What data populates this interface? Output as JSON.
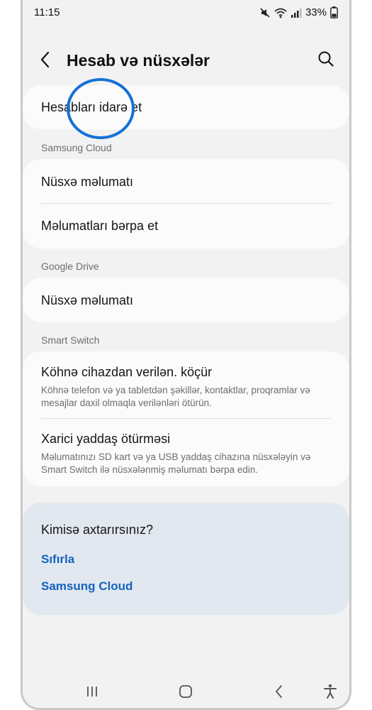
{
  "status_bar": {
    "time": "11:15",
    "battery": "33%"
  },
  "header": {
    "title": "Hesab və nüsxələr",
    "icons": [
      "back-arrow-icon",
      "search-icon"
    ]
  },
  "accounts_card": {
    "item_label": "Hesabları idarə et"
  },
  "samsung_cloud": {
    "section_label": "Samsung Cloud",
    "items": [
      {
        "label": "Nüsxə məlumatı"
      },
      {
        "label": "Məlumatları bərpa et"
      }
    ]
  },
  "google_drive": {
    "section_label": "Google Drive",
    "items": [
      {
        "label": "Nüsxə məlumatı"
      }
    ]
  },
  "smart_switch": {
    "section_label": "Smart Switch",
    "items": [
      {
        "label": "Köhnə cihazdan verilən. köçür",
        "desc_line1": "Köhnə telefon və ya tabletdən şəkillər, kontaktlar, proqramlar və",
        "desc_line2": "mesajlar daxil olmaqla verilənləri ötürün."
      },
      {
        "label": "Xarici yaddaş ötürməsi",
        "desc_line1": "Məlumatınızı SD kart və ya USB yaddaş cihazına nüsxələyin və",
        "desc_line2": "Smart Switch ilə nüsxələnmiş məlumatı bərpa edin."
      }
    ]
  },
  "suggestions": {
    "title": "Kimisə axtarırsınız?",
    "links": [
      "Sıfırla",
      "Samsung Cloud"
    ]
  },
  "navigation_bar": {
    "icons": [
      "recents-icon",
      "home-icon",
      "back-icon",
      "accessibility-icon"
    ]
  },
  "colors": {
    "background": "#f2f2f2",
    "card": "#fbfbfb",
    "suggestion_card": "#e2e8ef",
    "link": "#1363c0",
    "highlight": "#1471d6"
  }
}
